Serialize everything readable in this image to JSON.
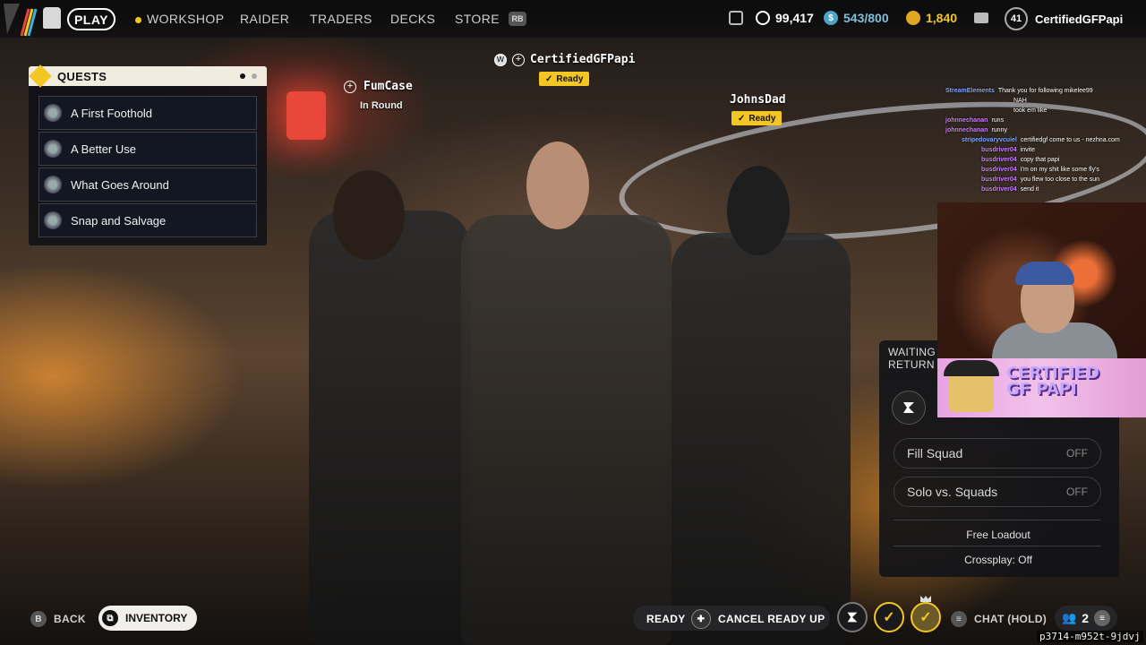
{
  "topnav": {
    "play": "PLAY",
    "items": [
      "WORKSHOP",
      "RAIDER",
      "TRADERS",
      "DECKS",
      "STORE"
    ],
    "rb_badge": "RB",
    "currencies": {
      "coins": "99,417",
      "credits": "543/800",
      "tokens": "1,840"
    },
    "level": "41",
    "username": "CertifiedGFPapi",
    "colors": {
      "accent": "#f3c624"
    }
  },
  "quests": {
    "title": "QUESTS",
    "items": [
      "A First Foothold",
      "A Better Use",
      "What Goes Around",
      "Snap and Salvage"
    ]
  },
  "players": {
    "left": {
      "name": "FumCase",
      "status": "In Round"
    },
    "center": {
      "name": "CertifiedGFPapi",
      "badge": "Ready",
      "check": "✓"
    },
    "right": {
      "name": "JohnsDad",
      "badge": "Ready",
      "check": "✓"
    }
  },
  "chat": [
    {
      "user": "StreamElements",
      "msg": "Thank you for following mikelee99"
    },
    {
      "user": "",
      "msg": "NAH"
    },
    {
      "user": "",
      "msg": "took em like"
    },
    {
      "user": "johnnechanan",
      "msg": "runs"
    },
    {
      "user": "johnnechanan",
      "msg": "runny"
    },
    {
      "user": "stripedovaryvcuiel",
      "msg": "certifiedgf come to us - nezhna.com"
    },
    {
      "user": "busdriver04",
      "msg": "invite"
    },
    {
      "user": "busdriver04",
      "msg": "copy that papi"
    },
    {
      "user": "busdriver04",
      "msg": "I'm on my shit like some fly's"
    },
    {
      "user": "busdriver04",
      "msg": "you flew too close to the sun"
    },
    {
      "user": "busdriver04",
      "msg": "send it"
    }
  ],
  "overlay": {
    "banner_line1": "CERTIFIED",
    "banner_line2": "GF PAPI"
  },
  "panel": {
    "waiting_line1": "WAITING F",
    "waiting_line2": "RETURN T",
    "fill_squad": {
      "label": "Fill Squad",
      "value": "OFF"
    },
    "solo_vs_squads": {
      "label": "Solo vs. Squads",
      "value": "OFF"
    },
    "free_loadout": "Free Loadout",
    "crossplay": "Crossplay: Off"
  },
  "bottom": {
    "back_key": "B",
    "back": "BACK",
    "inventory": "INVENTORY",
    "ready": "READY",
    "cancel_ready": "CANCEL READY UP",
    "chat": "CHAT (HOLD)",
    "squad_count": "2",
    "session_id": "p3714-m952t-9jdvj"
  }
}
